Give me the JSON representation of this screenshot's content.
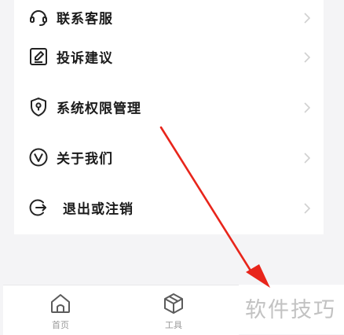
{
  "menu": {
    "items": [
      {
        "label": "联系客服",
        "icon": "headset-icon"
      },
      {
        "label": "投诉建议",
        "icon": "edit-note-icon"
      },
      {
        "label": "系统权限管理",
        "icon": "shield-lock-icon"
      },
      {
        "label": "关于我们",
        "icon": "v-badge-icon"
      },
      {
        "label": "退出或注销",
        "icon": "logout-icon"
      }
    ]
  },
  "tabbar": {
    "tabs": [
      {
        "label": "首页",
        "icon": "home-icon"
      },
      {
        "label": "工具",
        "icon": "toolbox-cube-icon"
      }
    ]
  },
  "watermark": {
    "text": "软件技巧"
  },
  "colors": {
    "annotation_arrow": "#e8251b",
    "text": "#1b1b1b",
    "tab_label": "#9a9a9a"
  }
}
